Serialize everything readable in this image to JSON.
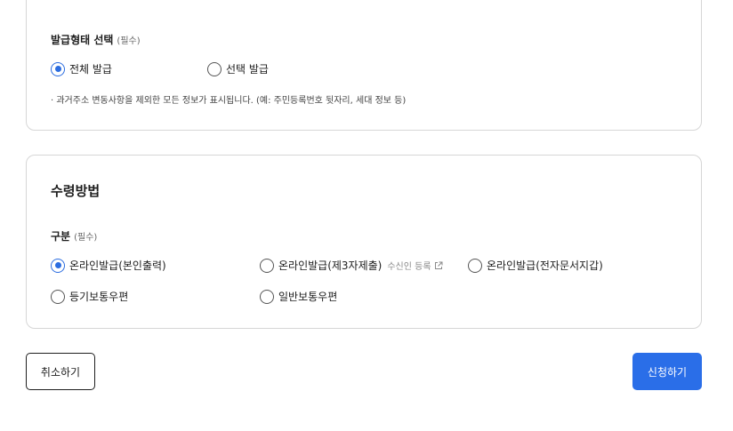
{
  "issue_type": {
    "label": "발급형태 선택",
    "required": "(필수)",
    "options": [
      {
        "label": "전체 발급",
        "checked": true
      },
      {
        "label": "선택 발급",
        "checked": false
      }
    ],
    "note": "· 과거주소 변동사항을 제외한 모든 정보가 표시됩니다. (예: 주민등록번호 뒷자리, 세대 정보 등)"
  },
  "receipt": {
    "title": "수령방법",
    "label": "구분",
    "required": "(필수)",
    "options": [
      {
        "label": "온라인발급(본인출력)",
        "checked": true
      },
      {
        "label": "온라인발급(제3자제출)",
        "checked": false,
        "link": "수신인 등록"
      },
      {
        "label": "온라인발급(전자문서지갑)",
        "checked": false
      },
      {
        "label": "등기보통우편",
        "checked": false
      },
      {
        "label": "일반보통우편",
        "checked": false
      }
    ]
  },
  "buttons": {
    "cancel": "취소하기",
    "apply": "신청하기"
  },
  "colors": {
    "accent": "#2a6ee8",
    "border": "#d6d6d6"
  },
  "icons": {
    "external_link": "external-link-icon"
  }
}
